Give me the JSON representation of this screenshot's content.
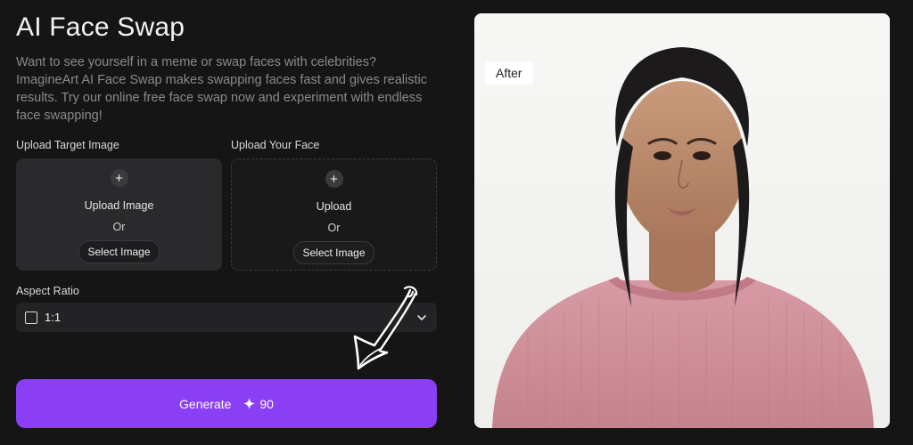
{
  "header": {
    "title": "AI Face Swap",
    "description": "Want to see yourself in a meme or swap faces with celebrities? ImagineArt AI Face Swap makes swapping faces fast and gives realistic results. Try our online free face swap now and experiment with endless face swapping!"
  },
  "upload_target": {
    "label": "Upload Target Image",
    "plus": "+",
    "upload_text": "Upload Image",
    "or_text": "Or",
    "select_button": "Select Image"
  },
  "upload_face": {
    "label": "Upload Your Face",
    "plus": "+",
    "upload_text": "Upload",
    "or_text": "Or",
    "select_button": "Select Image"
  },
  "aspect_ratio": {
    "label": "Aspect Ratio",
    "selected": "1:1"
  },
  "generate": {
    "label": "Generate",
    "credits": "90"
  },
  "preview": {
    "badge": "After"
  },
  "colors": {
    "accent": "#8a3ff5",
    "background": "#151516",
    "panel": "#2a2a2c"
  }
}
